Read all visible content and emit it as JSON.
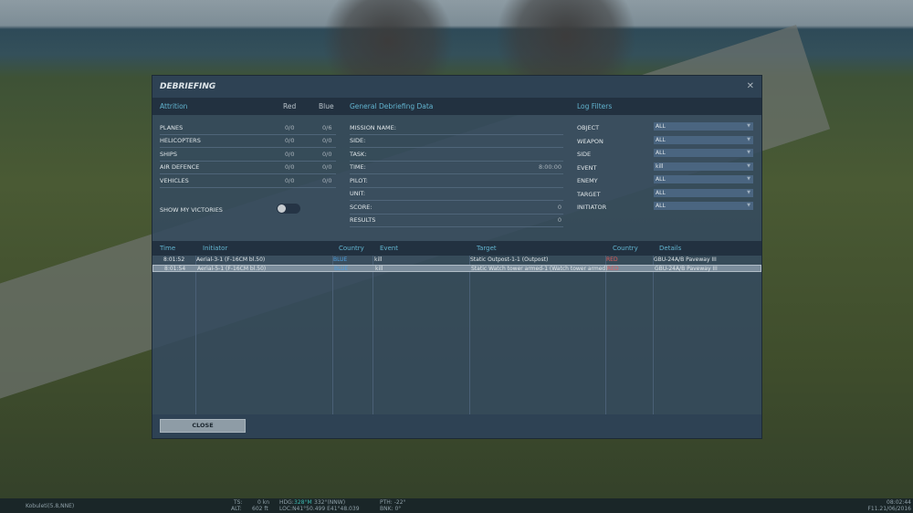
{
  "dialog": {
    "title": "DEBRIEFING",
    "close_icon": "close-icon"
  },
  "attrition": {
    "header": "Attrition",
    "col_red": "Red",
    "col_blue": "Blue",
    "rows": [
      {
        "label": "PLANES",
        "red": "0/0",
        "blue": "0/6"
      },
      {
        "label": "HELICOPTERS",
        "red": "0/0",
        "blue": "0/0"
      },
      {
        "label": "SHIPS",
        "red": "0/0",
        "blue": "0/0"
      },
      {
        "label": "AIR DEFENCE",
        "red": "0/0",
        "blue": "0/0"
      },
      {
        "label": "VEHICLES",
        "red": "0/0",
        "blue": "0/0"
      }
    ],
    "show_victories": "SHOW MY VICTORIES",
    "show_victories_on": false
  },
  "general": {
    "header": "General Debriefing Data",
    "rows": [
      {
        "label": "MISSION NAME:",
        "value": ""
      },
      {
        "label": "SIDE:",
        "value": ""
      },
      {
        "label": "TASK:",
        "value": ""
      },
      {
        "label": "TIME:",
        "value": "8:00:00"
      },
      {
        "label": "PILOT:",
        "value": ""
      },
      {
        "label": "UNIT:",
        "value": ""
      },
      {
        "label": "SCORE:",
        "value": "0"
      },
      {
        "label": "RESULTS",
        "value": "0"
      }
    ]
  },
  "filters": {
    "header": "Log Filters",
    "rows": [
      {
        "label": "OBJECT",
        "value": "ALL"
      },
      {
        "label": "WEAPON",
        "value": "ALL"
      },
      {
        "label": "SIDE",
        "value": "ALL"
      },
      {
        "label": "EVENT",
        "value": "kill"
      },
      {
        "label": "ENEMY",
        "value": "ALL"
      },
      {
        "label": "TARGET",
        "value": "ALL"
      },
      {
        "label": "INITIATOR",
        "value": "ALL"
      }
    ]
  },
  "log": {
    "columns": [
      "Time",
      "Initiator",
      "Country",
      "Event",
      "Target",
      "Country",
      "Details"
    ],
    "rows": [
      {
        "time": "8:01:52",
        "initiator": "Aerial-3-1 (F-16CM bl.50)",
        "country": "BLUE",
        "event": "kill",
        "target": "Static Outpost-1-1 (Outpost)",
        "target_country": "RED",
        "details": "GBU-24A/B Paveway III"
      },
      {
        "time": "8:01:54",
        "initiator": "Aerial-5-1 (F-16CM bl.50)",
        "country": "BLUE",
        "event": "kill",
        "target": "Static Watch tower armed-1 (Watch tower armed)",
        "target_country": "RED",
        "details": "GBU-24A/B Paveway III"
      }
    ]
  },
  "footer": {
    "close_label": "CLOSE"
  },
  "status": {
    "location": "Kobuleti(5.8,NNE)",
    "ts_label": "TS:",
    "ts": "0 kn",
    "alt_label": "ALT:",
    "alt": "602 ft",
    "hdg_label": "HDG:",
    "hdg_mag": "328°M",
    "hdg_true": "332°(NNW)",
    "loc": "LOC:N41°50.499 E41°48.039",
    "pth": "PTH: -22°",
    "bnk": "BNK: 0°",
    "time": "08:02:44",
    "date": "F11.21/06/2016"
  }
}
